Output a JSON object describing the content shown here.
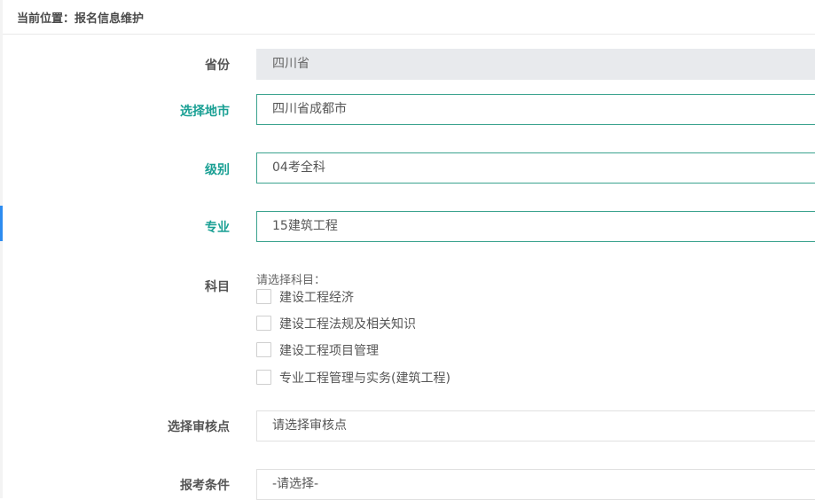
{
  "breadcrumb": {
    "text": "当前位置：报名信息维护"
  },
  "form": {
    "province": {
      "label": "省份",
      "value": "四川省"
    },
    "city": {
      "label": "选择地市",
      "value": "四川省成都市"
    },
    "level": {
      "label": "级别",
      "value": "04考全科"
    },
    "major": {
      "label": "专业",
      "value": "15建筑工程"
    },
    "subjects": {
      "label": "科目",
      "prompt": "请选择科目：",
      "options": [
        {
          "label": "建设工程经济",
          "checked": false
        },
        {
          "label": "建设工程法规及相关知识",
          "checked": false
        },
        {
          "label": "建设工程项目管理",
          "checked": false
        },
        {
          "label": "专业工程管理与实务(建筑工程)",
          "checked": false
        }
      ]
    },
    "review_point": {
      "label": "选择审核点",
      "value": "请选择审核点"
    },
    "condition": {
      "label": "报考条件",
      "value": "-请选择-"
    }
  },
  "colors": {
    "active_label": "#1aa094",
    "active_border": "#3aa28e",
    "disabled_bg": "#e8eaed",
    "rail_accent": "#2d8cf0"
  }
}
